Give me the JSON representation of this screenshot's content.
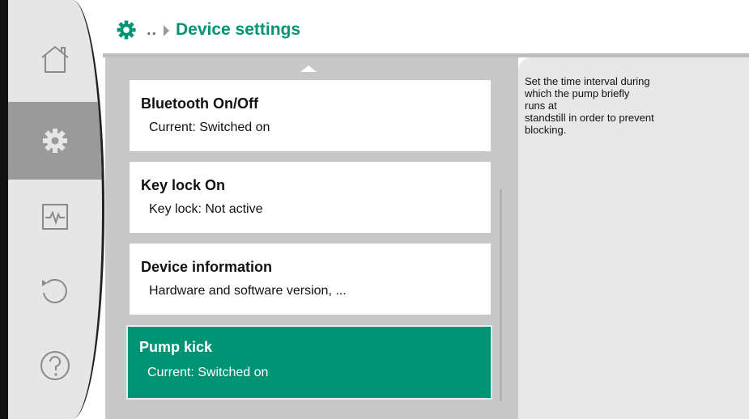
{
  "header": {
    "breadcrumb_dots": "..",
    "title": "Device settings",
    "icons": {
      "settings": "gear-icon",
      "separator": "triangle-right-icon"
    }
  },
  "sidebar": {
    "items": [
      {
        "name": "home",
        "icon": "home-icon",
        "active": false
      },
      {
        "name": "settings",
        "icon": "gear-icon",
        "active": true
      },
      {
        "name": "diagnostics",
        "icon": "pulse-icon",
        "active": false
      },
      {
        "name": "restore",
        "icon": "undo-icon",
        "active": false
      },
      {
        "name": "help",
        "icon": "help-icon",
        "active": false
      }
    ]
  },
  "menu": {
    "items": [
      {
        "title": "Bluetooth On/Off",
        "subtitle": "Current: Switched on",
        "selected": false
      },
      {
        "title": "Key lock On",
        "subtitle": "Key lock: Not active",
        "selected": false
      },
      {
        "title": "Device information",
        "subtitle": "Hardware and software version, ...",
        "selected": false
      },
      {
        "title": "Pump kick",
        "subtitle": "Current: Switched on",
        "selected": true
      }
    ]
  },
  "help": {
    "text": "Set the time interval during\nwhich the pump briefly\nruns at\nstandstill in order to prevent\nblocking."
  },
  "colors": {
    "accent": "#009475",
    "sidebar_bg": "#e6e6e6",
    "sidebar_active": "#9a9a9a",
    "main_bg": "#c8c8c8",
    "help_bg": "#e8e8e8"
  }
}
